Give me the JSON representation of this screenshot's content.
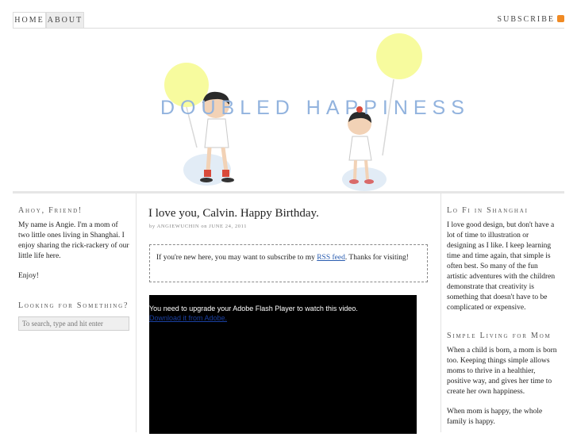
{
  "nav": {
    "home": "HOME",
    "about": "ABOUT",
    "subscribe": "SUBSCRIBE"
  },
  "header": {
    "site_title": "DOUBLED HAPPINESS",
    "title_color": "#92b3de",
    "balloon_color": "#f7fb9e"
  },
  "sidebar_left": {
    "widget1": {
      "title": "Ahoy, Friend!",
      "paragraphs": [
        "My name is Angie. I'm a mom of two little ones living in Shanghai. I enjoy sharing the rick-rackery of our little life here.",
        "Enjoy!"
      ]
    },
    "widget2": {
      "title": "Looking for Something?",
      "search_placeholder": "To search, type and hit enter"
    }
  },
  "post": {
    "title": "I love you, Calvin. Happy Birthday.",
    "meta_by": "by",
    "author": "ANGIEWUCHIN",
    "meta_on": "on",
    "date": "JUNE 24, 2011",
    "notice_before": "If you're new here, you may want to subscribe to my",
    "notice_link": "RSS feed",
    "notice_after": ". Thanks for visiting!",
    "video_message": "You need to upgrade your Adobe Flash Player to watch this video.",
    "video_link": "Download it from Adobe."
  },
  "sidebar_right": {
    "widget1": {
      "title": "Lo Fi in Shanghai",
      "text": "I love good design, but don't have a lot of time to illustration or designing as I like. I keep learning time and time again, that simple is often best. So many of the fun artistic adventures with the children demonstrate that creativity is something that doesn't have to be complicated or expensive."
    },
    "widget2": {
      "title": "Simple Living for Mom",
      "paragraphs": [
        "When a child is born, a mom is born too. Keeping things simple allows moms to thrive in a healthier, positive way, and gives her time to create her own happiness.",
        "When mom is happy, the whole family is happy."
      ]
    }
  }
}
